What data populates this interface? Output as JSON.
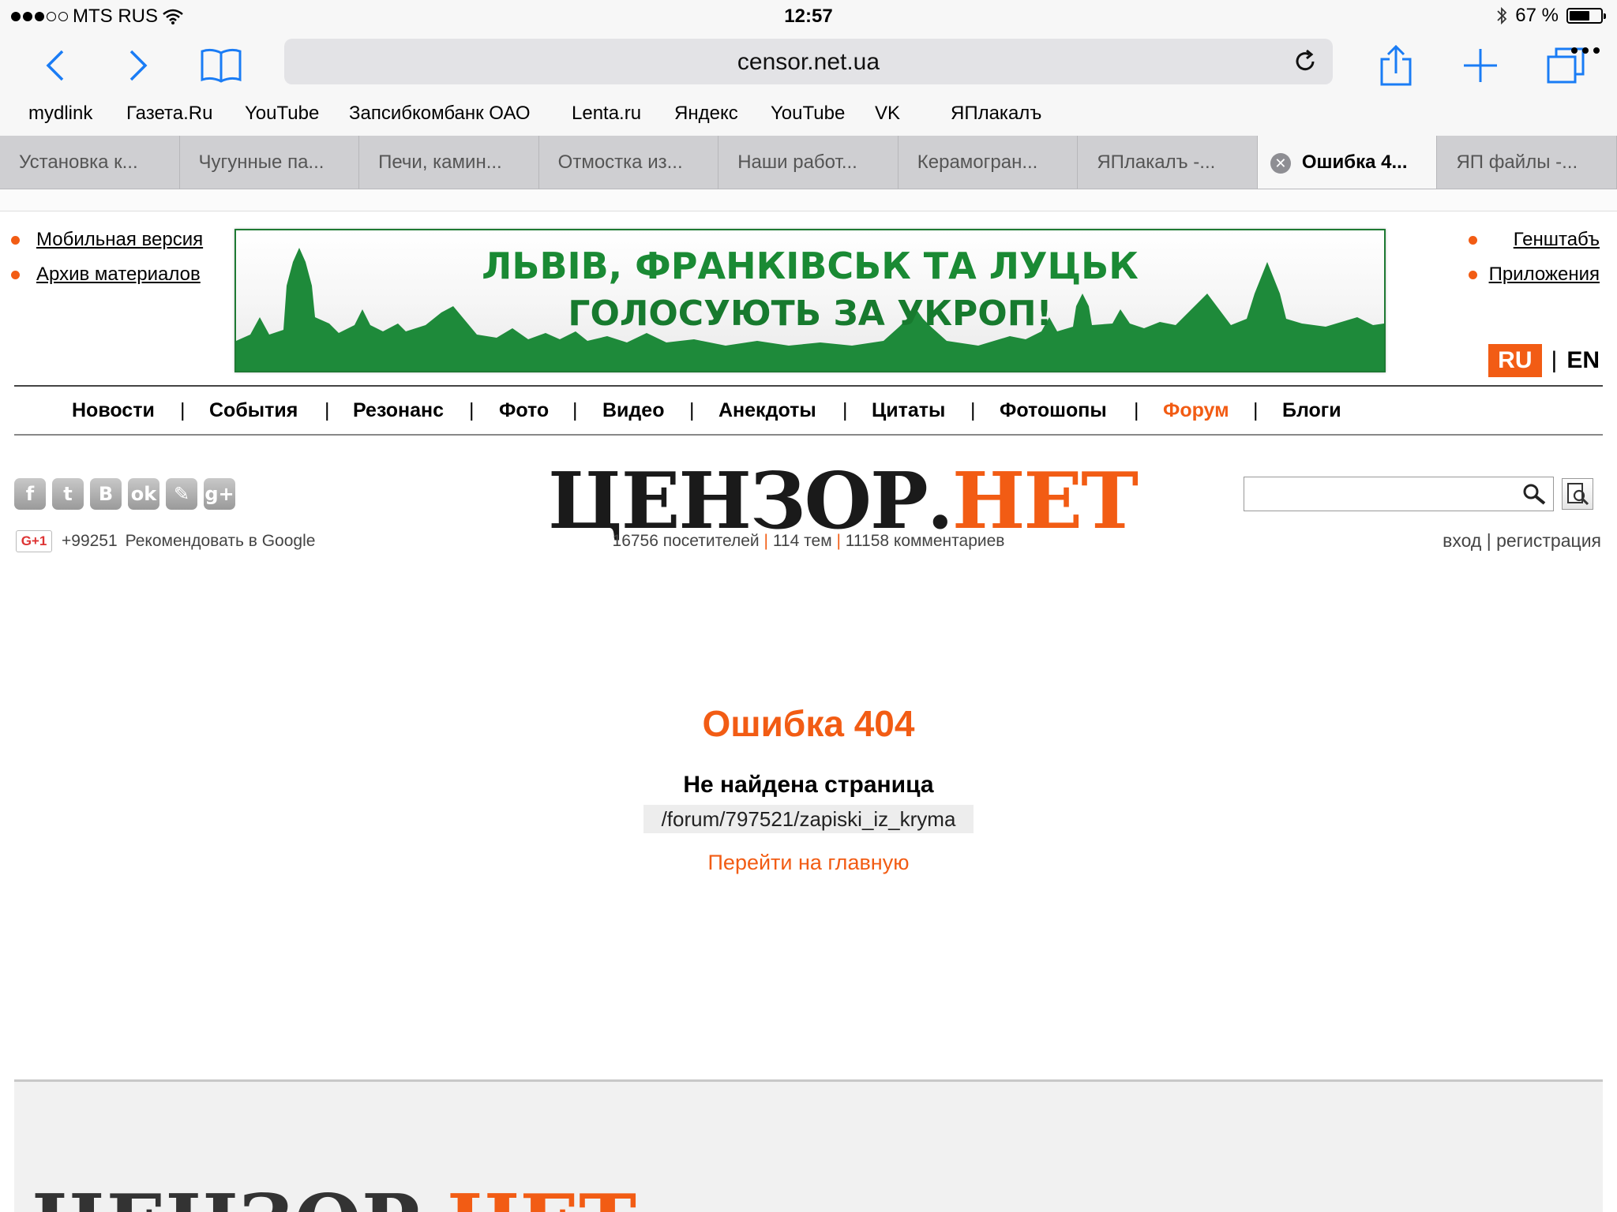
{
  "status": {
    "carrier": "MTS RUS",
    "time": "12:57",
    "battery": "67 %",
    "battery_level": 0.67
  },
  "browser": {
    "url": "censor.net.ua",
    "bookmarks": [
      "mydlink",
      "Газета.Ru",
      "YouTube",
      "Запсибкомбанк ОАО",
      "Lenta.ru",
      "Яндекс",
      "YouTube",
      "VK",
      "ЯПлакалъ"
    ],
    "tabs": [
      "Установка к...",
      "Чугунные па...",
      "Печи, камин...",
      "Отмостка из...",
      "Наши работ...",
      "Керамогран...",
      "ЯПлакалъ -...",
      "Ошибка 4...",
      "ЯП файлы -..."
    ],
    "active_tab": 7
  },
  "site": {
    "left_links": [
      "Мобильная версия",
      "Архив материалов"
    ],
    "right_links": [
      "Генштабъ",
      "Приложения"
    ],
    "banner": {
      "line1": "ЛЬВІВ, ФРАНКІВСЬК ТА ЛУЦЬК",
      "line2": "ГОЛОСУЮТЬ ЗА УКРОП!"
    },
    "lang": {
      "ru": "RU",
      "sep": "|",
      "en": "EN"
    },
    "nav": [
      "Новости",
      "События",
      "Резонанс",
      "Фото",
      "Видео",
      "Анекдоты",
      "Цитаты",
      "Фотошопы",
      "Форум",
      "Блоги"
    ],
    "nav_sep": "|",
    "nav_highlight": "Форум",
    "social": [
      "f",
      "t",
      "B",
      "ok",
      "✎",
      "g+"
    ],
    "gplus": {
      "label": "G+1",
      "count": "+99251",
      "recommend": "Рекомендовать в Google"
    },
    "logo": {
      "part1": "ЦЕНЗОР.",
      "part2": "НЕТ"
    },
    "stats": {
      "visitors": "16756 посетителей",
      "topics": "114 тем",
      "comments": "11158 комментариев",
      "sep": "|"
    },
    "auth": {
      "login": "вход",
      "sep": "|",
      "register": "регистрация"
    }
  },
  "error": {
    "title": "Ошибка 404",
    "subtitle": "Не найдена страница",
    "path": "/forum/797521/zapiski_iz_kryma",
    "home_link": "Перейти на главную"
  },
  "colors": {
    "accent": "#f25c14",
    "banner_green": "#1a8a34"
  }
}
